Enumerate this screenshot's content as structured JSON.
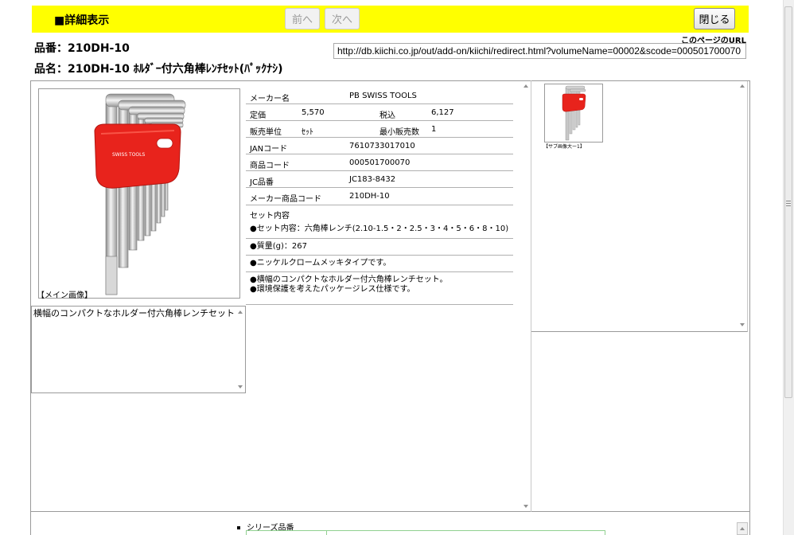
{
  "header": {
    "title": "■詳細表示",
    "prev_label": "前へ",
    "next_label": "次へ",
    "close_label": "閉じる"
  },
  "page_url": {
    "label": "このページのURL",
    "value": "http://db.kiichi.co.jp/out/add-on/kiichi/redirect.html?volumeName=00002&scode=000501700070"
  },
  "product": {
    "hinban": "品番：210DH-10",
    "hinmei": "品名：210DH-10 ﾎﾙﾀﾞｰ付六角棒ﾚﾝﾁｾｯﾄ(ﾊﾟｯｸﾅｼ)"
  },
  "main_image": {
    "caption": "【メイン画像】",
    "brand_text": "SWISS TOOLS"
  },
  "description": "横幅のコンパクトなホルダー付六角棒レンチセット",
  "spec": {
    "maker_label": "メーカー名",
    "maker_value": "PB SWISS TOOLS",
    "price_label": "定価",
    "price_value": "5,570",
    "tax_label": "税込",
    "tax_value": "6,127",
    "unit_label": "販売単位",
    "unit_value": "ｾｯﾄ",
    "min_label": "最小販売数",
    "min_value": "1",
    "jan_label": "JANコード",
    "jan_value": "7610733017010",
    "code_label": "商品コード",
    "code_value": "000501700070",
    "jc_label": "JC品番",
    "jc_value": "JC183-8432",
    "maker_code_label": "メーカー商品コード",
    "maker_code_value": "210DH-10",
    "set_title": "セット内容",
    "set_items": [
      "●セット内容：六角棒レンチ(2.10-1.5・2・2.5・3・4・5・6・8・10)",
      "●質量(g)：267",
      "●ニッケルクロームメッキタイプです。"
    ],
    "features": [
      "●横幅のコンパクトなホルダー付六角棒レンチセット。",
      "●環境保護を考えたパッケージレス仕様です。"
    ]
  },
  "thumbnail": {
    "caption": "【サブ画像大ー1】"
  },
  "series": {
    "label": "シリーズ品番"
  },
  "colors": {
    "header_bg": "#ffff00",
    "holder_red": "#e8231c",
    "series_border": "#90d090"
  }
}
